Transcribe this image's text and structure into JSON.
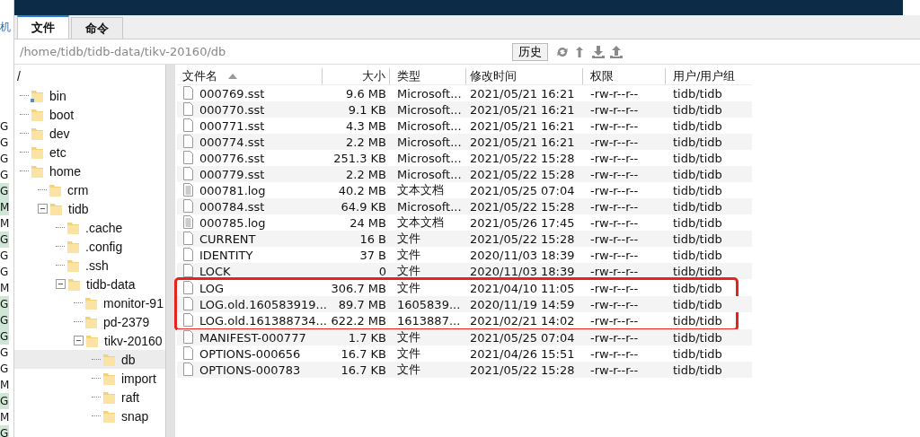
{
  "left_strip": {
    "title": "机",
    "items": [
      {
        "text": "G",
        "highlighted": false
      },
      {
        "text": "G",
        "highlighted": false
      },
      {
        "text": "G",
        "highlighted": false
      },
      {
        "text": "G",
        "highlighted": false
      },
      {
        "text": "G",
        "highlighted": true
      },
      {
        "text": "M",
        "highlighted": true
      },
      {
        "text": "M",
        "highlighted": false
      },
      {
        "text": "G",
        "highlighted": true
      },
      {
        "text": "G",
        "highlighted": false
      },
      {
        "text": "G",
        "highlighted": false
      },
      {
        "text": "M",
        "highlighted": false
      },
      {
        "text": "G",
        "highlighted": true
      },
      {
        "text": "G",
        "highlighted": true
      },
      {
        "text": "G",
        "highlighted": true
      },
      {
        "text": "G",
        "highlighted": false
      },
      {
        "text": "G",
        "highlighted": false
      },
      {
        "text": "M",
        "highlighted": false
      },
      {
        "text": "G",
        "highlighted": true
      },
      {
        "text": "M",
        "highlighted": false
      },
      {
        "text": "G",
        "highlighted": true
      }
    ]
  },
  "tabs": [
    {
      "label": "文件",
      "selected": true
    },
    {
      "label": "命令",
      "selected": false
    }
  ],
  "path_bar": {
    "path": "/home/tidb/tidb-data/tikv-20160/db",
    "history_button": "历史"
  },
  "tree": {
    "root": "/",
    "items": [
      {
        "label": "bin",
        "selected": false,
        "kind": "link"
      },
      {
        "label": "boot",
        "selected": false
      },
      {
        "label": "dev",
        "selected": false
      },
      {
        "label": "etc",
        "selected": false
      },
      {
        "label": "home",
        "selected": false,
        "children": [
          {
            "label": "crm",
            "selected": false
          },
          {
            "label": "tidb",
            "selected": false,
            "expanded": true,
            "children": [
              {
                "label": ".cache",
                "selected": false
              },
              {
                "label": ".config",
                "selected": false
              },
              {
                "label": ".ssh",
                "selected": false
              },
              {
                "label": "tidb-data",
                "selected": false,
                "expanded": true,
                "children": [
                  {
                    "label": "monitor-91",
                    "selected": false
                  },
                  {
                    "label": "pd-2379",
                    "selected": false
                  },
                  {
                    "label": "tikv-20160",
                    "selected": false,
                    "expanded": true,
                    "children": [
                      {
                        "label": "db",
                        "selected": true
                      },
                      {
                        "label": "import",
                        "selected": false
                      },
                      {
                        "label": "raft",
                        "selected": false
                      },
                      {
                        "label": "snap",
                        "selected": false
                      }
                    ]
                  }
                ]
              }
            ]
          }
        ]
      }
    ]
  },
  "table": {
    "columns": [
      {
        "label": "文件名",
        "sorted": true
      },
      {
        "label": "大小",
        "sorted": false
      },
      {
        "label": "类型",
        "sorted": false
      },
      {
        "label": "修改时间",
        "sorted": false
      },
      {
        "label": "权限",
        "sorted": false
      },
      {
        "label": "用户/用户组",
        "sorted": false
      }
    ],
    "rows": [
      {
        "kind": "file",
        "boxed": false,
        "cells": [
          "000769.sst",
          "9.6 MB",
          "Microsoft...",
          "2021/05/21 16:21",
          "-rw-r--r--",
          "tidb/tidb"
        ]
      },
      {
        "kind": "file",
        "boxed": false,
        "cells": [
          "000770.sst",
          "9.1 KB",
          "Microsoft...",
          "2021/05/21 16:21",
          "-rw-r--r--",
          "tidb/tidb"
        ]
      },
      {
        "kind": "file",
        "boxed": false,
        "cells": [
          "000771.sst",
          "4.3 MB",
          "Microsoft...",
          "2021/05/21 16:21",
          "-rw-r--r--",
          "tidb/tidb"
        ]
      },
      {
        "kind": "file",
        "boxed": false,
        "cells": [
          "000774.sst",
          "2.2 MB",
          "Microsoft...",
          "2021/05/21 16:21",
          "-rw-r--r--",
          "tidb/tidb"
        ]
      },
      {
        "kind": "file",
        "boxed": false,
        "cells": [
          "000776.sst",
          "251.3 KB",
          "Microsoft...",
          "2021/05/22 15:28",
          "-rw-r--r--",
          "tidb/tidb"
        ]
      },
      {
        "kind": "file",
        "boxed": false,
        "cells": [
          "000779.sst",
          "2.2 MB",
          "Microsoft...",
          "2021/05/22 15:28",
          "-rw-r--r--",
          "tidb/tidb"
        ]
      },
      {
        "kind": "text",
        "boxed": false,
        "cells": [
          "000781.log",
          "40.2 MB",
          "文本文档",
          "2021/05/25 07:04",
          "-rw-r--r--",
          "tidb/tidb"
        ]
      },
      {
        "kind": "file",
        "boxed": false,
        "cells": [
          "000784.sst",
          "64.9 KB",
          "Microsoft...",
          "2021/05/22 15:28",
          "-rw-r--r--",
          "tidb/tidb"
        ]
      },
      {
        "kind": "text",
        "boxed": false,
        "cells": [
          "000785.log",
          "24 MB",
          "文本文档",
          "2021/05/26 17:45",
          "-rw-r--r--",
          "tidb/tidb"
        ]
      },
      {
        "kind": "file",
        "boxed": false,
        "cells": [
          "CURRENT",
          "16 B",
          "文件",
          "2021/05/22 15:28",
          "-rw-r--r--",
          "tidb/tidb"
        ]
      },
      {
        "kind": "file",
        "boxed": false,
        "cells": [
          "IDENTITY",
          "37 B",
          "文件",
          "2020/11/03 18:39",
          "-rw-r--r--",
          "tidb/tidb"
        ]
      },
      {
        "kind": "file",
        "boxed": false,
        "cells": [
          "LOCK",
          "0",
          "文件",
          "2020/11/03 18:39",
          "-rw-r--r--",
          "tidb/tidb"
        ]
      },
      {
        "kind": "file",
        "boxed": true,
        "cells": [
          "LOG",
          "306.7 MB",
          "文件",
          "2021/04/10 11:05",
          "-rw-r--r--",
          "tidb/tidb"
        ]
      },
      {
        "kind": "file",
        "boxed": true,
        "cells": [
          "LOG.old.160583919...",
          "89.7 MB",
          "1605839...",
          "2020/11/19 14:59",
          "-rw-r--r--",
          "tidb/tidb"
        ]
      },
      {
        "kind": "file",
        "boxed": true,
        "cells": [
          "LOG.old.161388734...",
          "622.2 MB",
          "1613887...",
          "2021/02/21 14:02",
          "-rw-r--r--",
          "tidb/tidb"
        ]
      },
      {
        "kind": "file",
        "boxed": false,
        "cells": [
          "MANIFEST-000777",
          "1.7 KB",
          "文件",
          "2021/05/25 07:04",
          "-rw-r--r--",
          "tidb/tidb"
        ]
      },
      {
        "kind": "file",
        "boxed": false,
        "cells": [
          "OPTIONS-000656",
          "16.7 KB",
          "文件",
          "2021/04/26 15:51",
          "-rw-r--r--",
          "tidb/tidb"
        ]
      },
      {
        "kind": "file",
        "boxed": false,
        "cells": [
          "OPTIONS-000783",
          "16.7 KB",
          "文件",
          "2021/05/22 15:28",
          "-rw-r--r--",
          "tidb/tidb"
        ]
      }
    ]
  }
}
